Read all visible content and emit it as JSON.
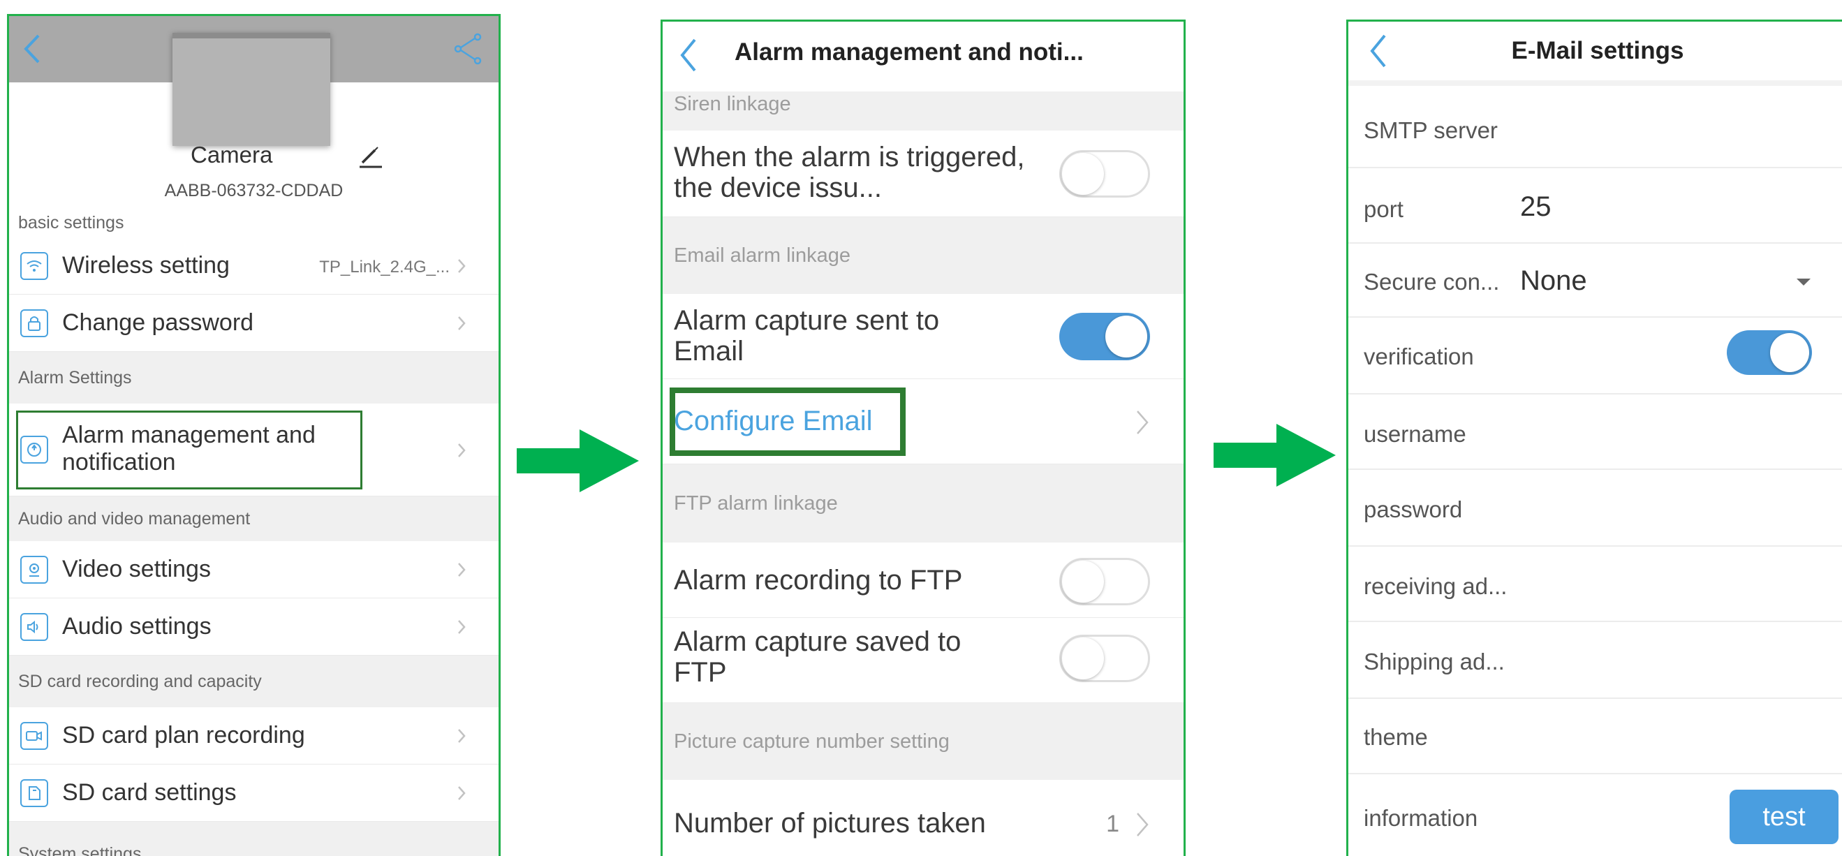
{
  "panel1": {
    "device_name": "Camera",
    "device_uid": "AABB-063732-CDDAD",
    "groups": {
      "basic": "basic settings",
      "alarm": "Alarm Settings",
      "av": "Audio and video management",
      "sd": "SD card recording and capacity",
      "system": "System settings"
    },
    "rows": {
      "wireless": {
        "label": "Wireless setting",
        "value": "TP_Link_2.4G_...",
        "icon": "wifi-icon"
      },
      "password": {
        "label": "Change password",
        "icon": "lock-icon"
      },
      "alarm": {
        "label": "Alarm management and notification",
        "icon": "alarm-icon"
      },
      "video": {
        "label": "Video settings",
        "icon": "video-icon"
      },
      "audio": {
        "label": "Audio settings",
        "icon": "speaker-icon"
      },
      "sd_plan": {
        "label": "SD card plan recording",
        "icon": "record-icon"
      },
      "sd_settings": {
        "label": "SD card settings",
        "icon": "sd-card-icon"
      }
    }
  },
  "panel2": {
    "title": "Alarm management and noti...",
    "groups": {
      "siren": "Siren linkage",
      "email": "Email alarm linkage",
      "ftp": "FTP alarm linkage",
      "picture": "Picture capture number setting"
    },
    "rows": {
      "siren_trigger": {
        "label": "When the alarm is triggered, the device issu...",
        "enabled": false
      },
      "email_capture": {
        "label": "Alarm capture sent to Email",
        "enabled": true
      },
      "configure_email": {
        "label": "Configure Email"
      },
      "ftp_recording": {
        "label": "Alarm recording to FTP",
        "enabled": false
      },
      "ftp_capture": {
        "label": "Alarm capture saved to FTP",
        "enabled": false
      },
      "pictures_taken": {
        "label": "Number of pictures taken",
        "value": "1"
      }
    }
  },
  "panel3": {
    "title": "E-Mail settings",
    "fields": {
      "smtp": {
        "label": "SMTP server",
        "value": ""
      },
      "port": {
        "label": "port",
        "value": "25"
      },
      "secure": {
        "label": "Secure con...",
        "value": "None"
      },
      "verification": {
        "label": "verification",
        "enabled": true
      },
      "username": {
        "label": "username",
        "value": ""
      },
      "password": {
        "label": "password",
        "value": ""
      },
      "receiving": {
        "label": "receiving ad...",
        "value": ""
      },
      "shipping": {
        "label": "Shipping ad...",
        "value": ""
      },
      "theme": {
        "label": "theme",
        "value": ""
      },
      "information": {
        "label": "information",
        "button": "test"
      }
    }
  },
  "colors": {
    "frame": "#22b14c",
    "highlight": "#2e7d32",
    "accent": "#4a98d8",
    "flow_arrow": "#00b050"
  }
}
